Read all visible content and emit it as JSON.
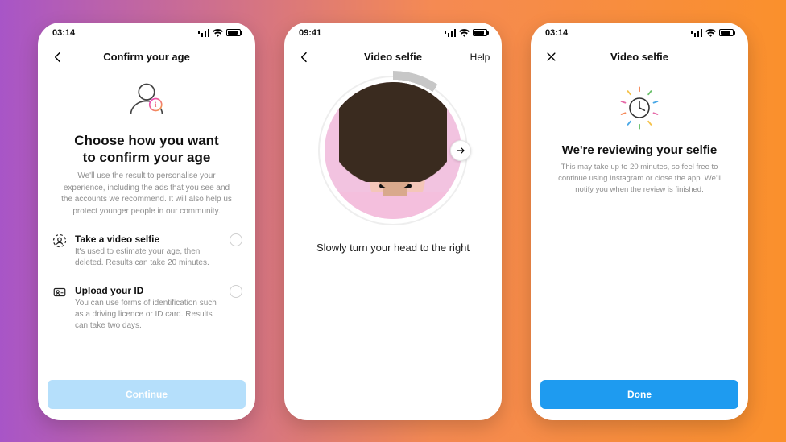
{
  "status": {
    "time1": "03:14",
    "time2": "09:41",
    "time3": "03:14"
  },
  "screen1": {
    "nav": {
      "title": "Confirm your age"
    },
    "heading": "Choose how you want to confirm your age",
    "sub": "We'll use the result to personalise your experience, including the ads that you see and the accounts we recommend. It will also help us protect younger people in our community.",
    "option1": {
      "title": "Take a video selfie",
      "desc": "It's used to estimate your age, then deleted. Results can take 20 minutes."
    },
    "option2": {
      "title": "Upload your ID",
      "desc": "You can use forms of identification such as a driving licence or ID card. Results can take two days."
    },
    "cta": "Continue"
  },
  "screen2": {
    "nav": {
      "title": "Video selfie",
      "help": "Help"
    },
    "instruction": "Slowly turn your head to the right"
  },
  "screen3": {
    "nav": {
      "title": "Video selfie"
    },
    "heading": "We're reviewing your selfie",
    "sub": "This may take up to 20 minutes, so feel free to continue using Instagram or close the app. We'll notify you when the review is finished.",
    "cta": "Done"
  }
}
